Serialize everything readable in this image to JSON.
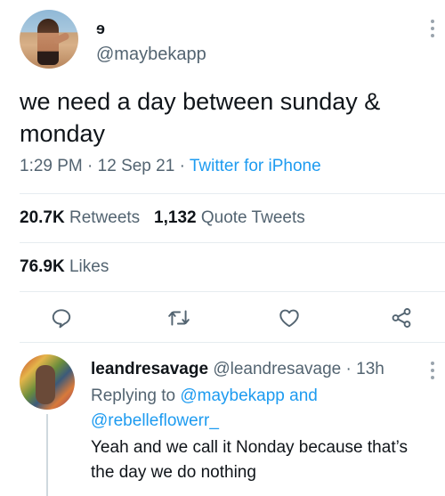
{
  "tweet": {
    "author_name": "ɘ",
    "author_handle": "@maybekapp",
    "text": "we need a day between sunday & monday",
    "time": "1:29 PM",
    "date": "12 Sep 21",
    "source": "Twitter for iPhone",
    "retweets_count": "20.7K",
    "retweets_label": "Retweets",
    "quote_count": "1,132",
    "quote_label": "Quote Tweets",
    "likes_count": "76.9K",
    "likes_label": "Likes"
  },
  "actions": [
    "reply-icon",
    "retweet-icon",
    "like-icon",
    "share-icon"
  ],
  "reply": {
    "author_name": "leandresavage",
    "author_handle": "@leandresavage",
    "time": "13h",
    "replying_prefix": "Replying to",
    "mention1": "@maybekapp",
    "and": "and",
    "mention2": "@rebelleflowerr_",
    "text": "Yeah and we call it Nonday because that’s the day we do nothing"
  },
  "colors": {
    "accent": "#1d9bf0",
    "muted": "#536471",
    "text": "#0f1419",
    "divider": "#e6ecf0"
  }
}
